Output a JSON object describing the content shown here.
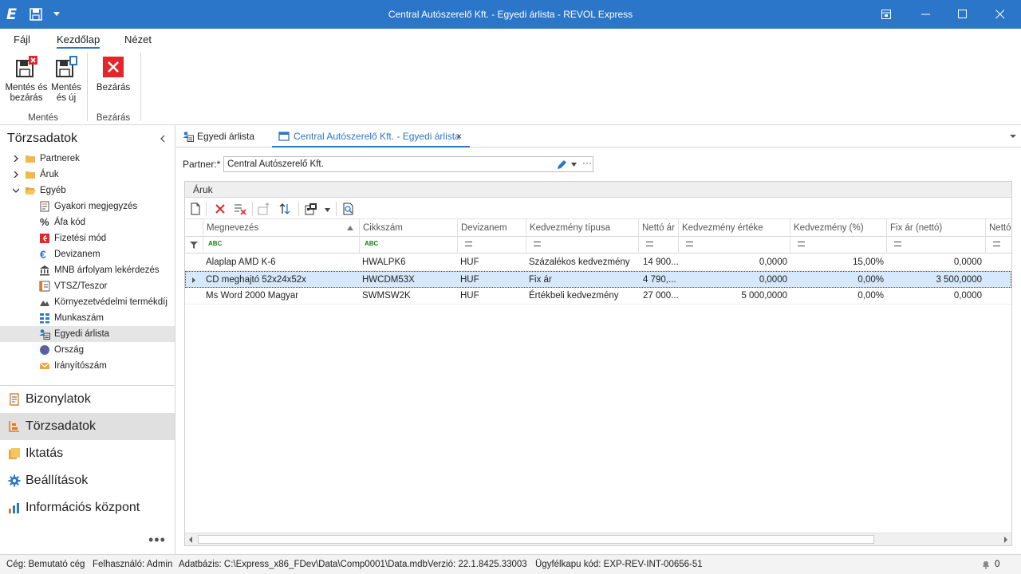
{
  "window": {
    "title": "Central Autószerelő Kft. - Egyedi árlista - REVOL Express",
    "logo": "E"
  },
  "ribbon": {
    "tabs": [
      {
        "label": "Fájl"
      },
      {
        "label": "Kezdőlap"
      },
      {
        "label": "Nézet"
      }
    ],
    "buttons": {
      "save_close": "Mentés és bezárás",
      "save_new": "Mentés és új",
      "close": "Bezárás"
    },
    "groups": {
      "save": "Mentés",
      "close": "Bezárás"
    }
  },
  "left_panel": {
    "title": "Törzsadatok",
    "tree": [
      {
        "label": "Partnerek",
        "icon": "folder-icon"
      },
      {
        "label": "Áruk",
        "icon": "folder-icon"
      },
      {
        "label": "Egyéb",
        "icon": "folder-open-icon"
      },
      {
        "label": "Gyakori megjegyzés",
        "icon": "note-icon"
      },
      {
        "label": "Áfa kód",
        "icon": "percent-icon"
      },
      {
        "label": "Fizetési mód",
        "icon": "payment-icon"
      },
      {
        "label": "Devizanem",
        "icon": "euro-icon"
      },
      {
        "label": "MNB árfolyam lekérdezés",
        "icon": "bank-icon"
      },
      {
        "label": "VTSZ/Teszor",
        "icon": "catalog-icon"
      },
      {
        "label": "Környezetvédelmi termékdíj",
        "icon": "eco-icon"
      },
      {
        "label": "Munkaszám",
        "icon": "grid-icon"
      },
      {
        "label": "Egyedi árlista",
        "icon": "pricelist-icon"
      },
      {
        "label": "Ország",
        "icon": "globe-icon"
      },
      {
        "label": "Irányítószám",
        "icon": "mail-icon"
      }
    ],
    "nav": [
      {
        "label": "Bizonylatok",
        "icon": "documents-icon"
      },
      {
        "label": "Törzsadatok",
        "icon": "master-data-icon"
      },
      {
        "label": "Iktatás",
        "icon": "filing-icon"
      },
      {
        "label": "Beállítások",
        "icon": "settings-icon"
      },
      {
        "label": "Információs központ",
        "icon": "chart-icon"
      }
    ],
    "more": "•••"
  },
  "doc_tabs": [
    {
      "label": "Egyedi árlista"
    },
    {
      "label": "Central Autószerelő Kft. - Egyedi árlista",
      "close": "×"
    }
  ],
  "partner": {
    "label": "Partner:*",
    "value": "Central Autószerelő Kft.",
    "more": "···"
  },
  "grid": {
    "caption": "Áruk",
    "columns": [
      "Megnevezés",
      "Cikkszám",
      "Devizanem",
      "Kedvezmény típusa",
      "Nettó ár",
      "Kedvezmény értéke",
      "Kedvezmény (%)",
      "Fix ár (nettó)",
      "Nettó"
    ],
    "filter_abc": "ABC",
    "rows": [
      {
        "name": "Alaplap AMD K-6",
        "sku": "HWALPK6",
        "currency": "HUF",
        "type": "Százalékos kedvezmény",
        "net": "14 900...",
        "disc_value": "0,0000",
        "disc_pct": "15,00%",
        "fixed": "0,0000"
      },
      {
        "name": "CD meghajtó 52x24x52x",
        "sku": "HWCDM53X",
        "currency": "HUF",
        "type": "Fix ár",
        "net": "4 790,...",
        "disc_value": "0,0000",
        "disc_pct": "0,00%",
        "fixed": "3 500,0000"
      },
      {
        "name": "Ms Word 2000 Magyar",
        "sku": "SWMSW2K",
        "currency": "HUF",
        "type": "Értékbeli kedvezmény",
        "net": "27 000...",
        "disc_value": "5 000,0000",
        "disc_pct": "0,00%",
        "fixed": "0,0000"
      }
    ]
  },
  "status": {
    "company": "Cég: Bemutató cég",
    "user": "Felhasználó: Admin",
    "database": "Adatbázis: C:\\Express_x86_FDev\\Data\\Comp0001\\Data.mdb",
    "version": "Verzió: 22.1.8425.33003",
    "client_code": "Ügyfélkapu kód: EXP-REV-INT-00656-51",
    "notifications": "0"
  },
  "colors": {
    "accent": "#2b76c8",
    "selected_row": "#d6e8fb",
    "close_red": "#e2262b"
  }
}
